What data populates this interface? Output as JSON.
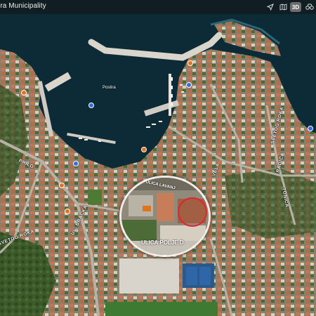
{
  "header": {
    "title": "ira Municipality",
    "controls": {
      "mode_3d": "3D",
      "location_icon": "location-arrow-icon",
      "map_icon": "map-icon",
      "binoculars_icon": "binoculars-icon"
    }
  },
  "map": {
    "harbor_label": "Postira",
    "streets": [
      "PRILO",
      "SVETOG ROKA",
      "UL. BRAČKA",
      "SVETOG ROKA",
      "VELA",
      "RADIĆA",
      "TONIĆA"
    ],
    "colors": {
      "sea": "#0d2a37",
      "accent_pin": "#e0731b",
      "blue_pin": "#2f6fe0",
      "target_ring": "#e0252b"
    }
  },
  "lens": {
    "top_label": "ULICA LAVANJ",
    "bottom_label": "ULICA POLJE D"
  }
}
